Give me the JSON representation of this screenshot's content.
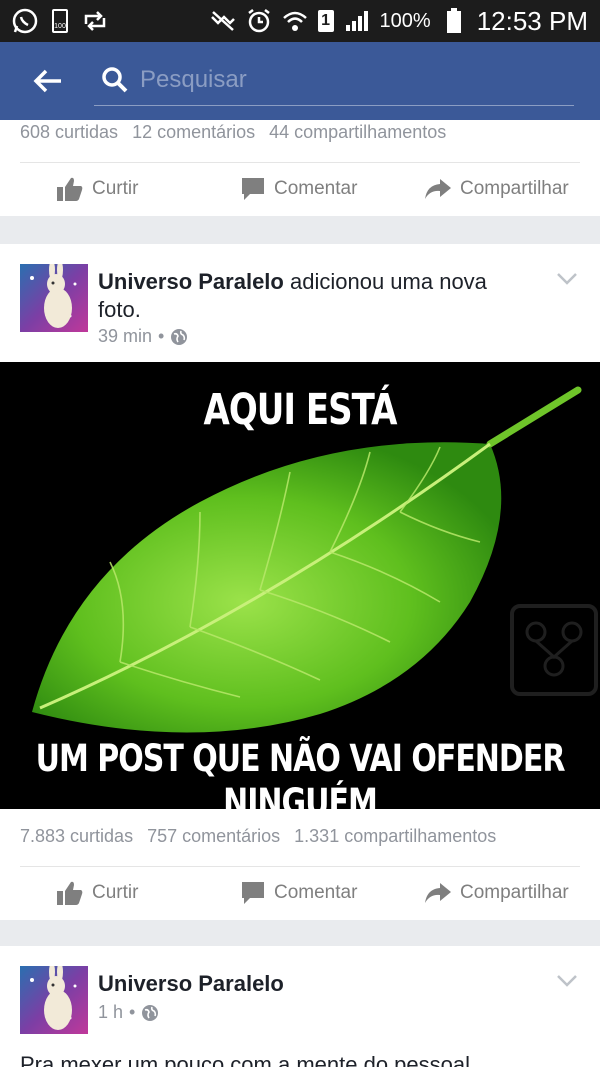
{
  "status_bar": {
    "battery_small_label": "100",
    "battery_percent": "100%",
    "sim_slot": "1",
    "time": "12:53 PM",
    "icons": [
      "whatsapp-icon",
      "battery-saver-icon",
      "retweet-icon",
      "mute-icon",
      "alarm-icon",
      "wifi-icon",
      "signal-icon",
      "battery-icon"
    ]
  },
  "app_bar": {
    "search_placeholder": "Pesquisar",
    "accent_color": "#3b5998"
  },
  "posts": [
    {
      "likes": "608 curtidas",
      "comments": "12 comentários",
      "shares": "44 compartilhamentos",
      "actions": {
        "like": "Curtir",
        "comment": "Comentar",
        "share": "Compartilhar"
      }
    },
    {
      "author": "Universo Paralelo",
      "action_text": "adicionou uma nova foto.",
      "time": "39 min",
      "privacy_icon": "globe-icon",
      "image_top_text": "AQUI ESTÁ",
      "image_bottom_text": "UM POST QUE NÃO VAI OFENDER NINGUÉM",
      "likes": "7.883 curtidas",
      "comments": "757 comentários",
      "shares": "1.331 compartilhamentos",
      "actions": {
        "like": "Curtir",
        "comment": "Comentar",
        "share": "Compartilhar"
      }
    },
    {
      "author": "Universo Paralelo",
      "time": "1 h",
      "privacy_icon": "globe-icon",
      "text": "Pra mexer um pouco com a mente do pessoal..."
    }
  ]
}
